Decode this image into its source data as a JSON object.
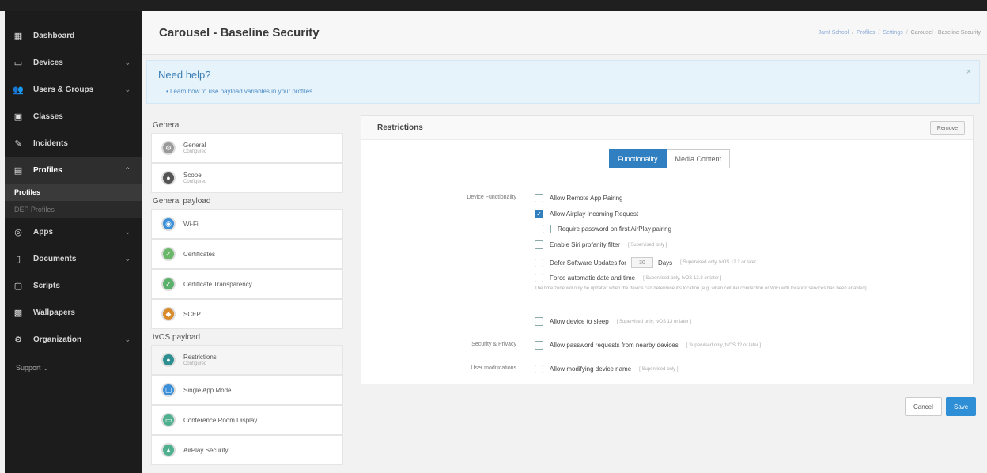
{
  "sidebar": {
    "items": [
      {
        "label": "Dashboard",
        "icon": "dashboard-icon"
      },
      {
        "label": "Devices",
        "icon": "monitor-icon"
      },
      {
        "label": "Users & Groups",
        "icon": "users-icon"
      },
      {
        "label": "Classes",
        "icon": "classes-icon"
      },
      {
        "label": "Incidents",
        "icon": "incidents-icon"
      },
      {
        "label": "Profiles",
        "icon": "profiles-icon"
      },
      {
        "label": "Apps",
        "icon": "apps-icon"
      },
      {
        "label": "Documents",
        "icon": "documents-icon"
      },
      {
        "label": "Scripts",
        "icon": "scripts-icon"
      },
      {
        "label": "Wallpapers",
        "icon": "wallpapers-icon"
      },
      {
        "label": "Organization",
        "icon": "organization-icon"
      }
    ],
    "sub_profiles": "Profiles",
    "sub_dep": "DEP Profiles",
    "support": "Support"
  },
  "header": {
    "title": "Carousel - Baseline Security",
    "breadcrumb": [
      "Jamf School",
      "Profiles",
      "Settings",
      "Carousel - Baseline Security"
    ]
  },
  "help": {
    "title": "Need help?",
    "link": "Learn how to use payload variables in your profiles"
  },
  "payload_sections": {
    "general": "General",
    "general_payload": "General payload",
    "tvos_payload": "tvOS payload"
  },
  "payloads": {
    "general": {
      "name": "General",
      "sub": "Configured"
    },
    "scope": {
      "name": "Scope",
      "sub": "Configured"
    },
    "wifi": {
      "name": "Wi-Fi"
    },
    "certificates": {
      "name": "Certificates"
    },
    "cert_transparency": {
      "name": "Certificate Transparency"
    },
    "scep": {
      "name": "SCEP"
    },
    "restrictions": {
      "name": "Restrictions",
      "sub": "Configured"
    },
    "single_app": {
      "name": "Single App Mode"
    },
    "conference_room": {
      "name": "Conference Room Display"
    },
    "airplay_security": {
      "name": "AirPlay Security"
    }
  },
  "restrictions": {
    "title": "Restrictions",
    "remove": "Remove",
    "tab_functionality": "Functionality",
    "tab_media": "Media Content",
    "group_device": "Device Functionality",
    "group_security": "Security & Privacy",
    "group_user": "User modifications",
    "options": {
      "remote_app": "Allow Remote App Pairing",
      "airplay_incoming": "Allow Airplay Incoming Request",
      "require_password": "Require password on first AirPlay pairing",
      "siri_filter": "Enable Siri profanity filter",
      "siri_note": "[ Supervised only ]",
      "defer_updates": "Defer Software Updates for",
      "defer_days": "Days",
      "defer_note": "[ Supervised only, tvOS 12.2 or later ]",
      "defer_value": "30",
      "force_datetime": "Force automatic date and time",
      "force_note": "[ Supervised only, tvOS 12.2 or later ]",
      "force_desc": "The time zone will only be updated when the device can determine it's location (e.g. when cellular connection or WiFi with location services has been enabled).",
      "sleep": "Allow device to sleep",
      "sleep_note": "[ Supervised only, tvOS 13 or later ]",
      "password_requests": "Allow password requests from nearby devices",
      "password_note": "[ Supervised only, tvOS 12 or later ]",
      "modify_name": "Allow modifying device name",
      "modify_note": "[ Supervised only ]"
    },
    "checked": {
      "remote_app": false,
      "airplay_incoming": true
    }
  },
  "footer": {
    "cancel": "Cancel",
    "save": "Save"
  },
  "colors": {
    "accent": "#2f7fc1",
    "sidebar_bg": "#1c1c1c",
    "help_bg": "#e6f3fb"
  }
}
